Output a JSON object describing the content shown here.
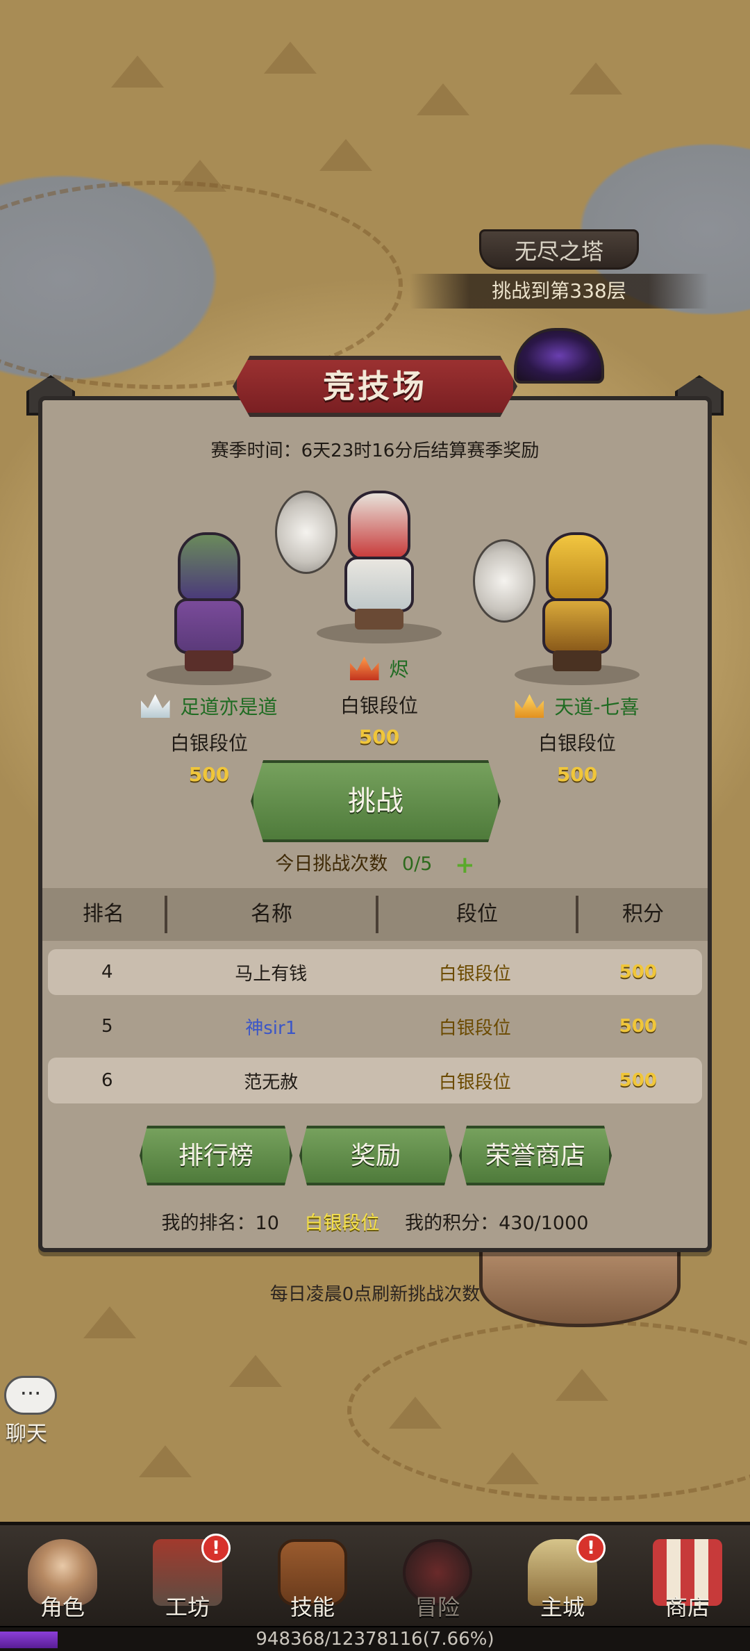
{
  "tower": {
    "title": "无尽之塔",
    "subtitle": "挑战到第338层"
  },
  "arena": {
    "title": "竞技场",
    "season": "赛季时间：6天23时16分后结算赛季奖励",
    "players": [
      {
        "name": "足道亦是道",
        "tier": "白银段位",
        "score": "500",
        "crown": "silver"
      },
      {
        "name": "烬",
        "tier": "白银段位",
        "score": "500",
        "crown": "red"
      },
      {
        "name": "天道-七喜",
        "tier": "白银段位",
        "score": "500",
        "crown": "gold"
      }
    ],
    "challenge_label": "挑战",
    "today_label": "今日挑战次数",
    "today_value": "0/5",
    "plus_symbol": "+",
    "table": {
      "headers": [
        "排名",
        "名称",
        "段位",
        "积分"
      ],
      "rows": [
        {
          "rank": "4",
          "name": "马上有钱",
          "tier": "白银段位",
          "score": "500"
        },
        {
          "rank": "5",
          "name": "神sir1",
          "tier": "白银段位",
          "score": "500"
        },
        {
          "rank": "6",
          "name": "范无赦",
          "tier": "白银段位",
          "score": "500"
        }
      ]
    },
    "buttons": {
      "leaderboard": "排行榜",
      "rewards": "奖励",
      "honor_shop": "荣誉商店"
    },
    "my_rank": "我的排名：10",
    "my_tier": "白银段位",
    "my_score": "我的积分：430/1000",
    "refresh_note": "每日凌晨0点刷新挑战次数"
  },
  "chat": {
    "bubble": "···",
    "label": "聊天"
  },
  "nav": [
    {
      "label": "角色",
      "icon": "hero-portrait-icon",
      "badge": ""
    },
    {
      "label": "工坊",
      "icon": "anvil-icon",
      "badge": "!"
    },
    {
      "label": "技能",
      "icon": "spellbook-icon",
      "badge": ""
    },
    {
      "label": "冒险",
      "icon": "crossed-swords-icon",
      "badge": ""
    },
    {
      "label": "主城",
      "icon": "castle-icon",
      "badge": "!"
    },
    {
      "label": "商店",
      "icon": "shop-stall-icon",
      "badge": ""
    }
  ],
  "exp": {
    "text": "948368/12378116(7.66%)",
    "fraction": 0.0766
  },
  "colors": {
    "panel": "#aa9e8d",
    "banner_red": "#9b3131",
    "button_green": "#5f8c48",
    "score_gold": "#f0c63a",
    "player_name_green": "#1f6b22",
    "exp_purple": "#7a33c2"
  }
}
